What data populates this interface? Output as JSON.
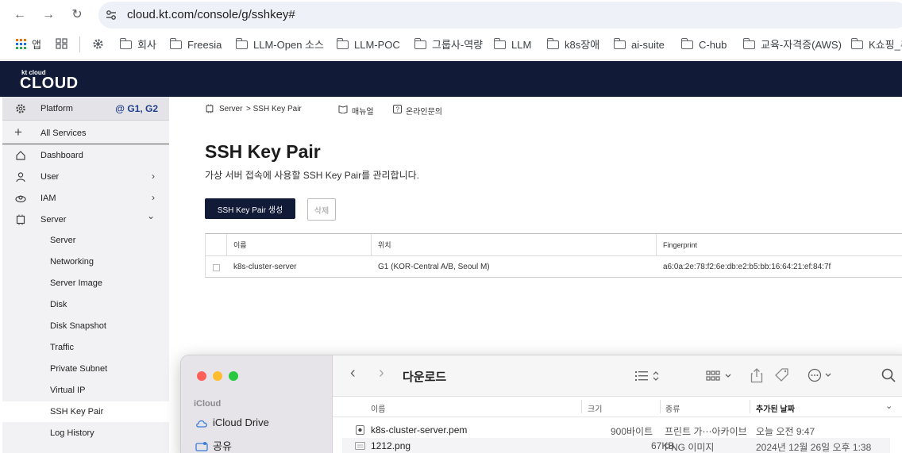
{
  "browser": {
    "url": "cloud.kt.com/console/g/sshkey#",
    "bookmarks": [
      "앱",
      "회사",
      "Freesia",
      "LLM-Open 소스",
      "LLM-POC",
      "그룹사-역량",
      "LLM",
      "k8s장애",
      "ai-suite",
      "C-hub",
      "교육-자격증(AWS)",
      "K쇼핑_추"
    ]
  },
  "header": {
    "logo_small": "kt cloud",
    "logo_big": "CLOUD"
  },
  "sidebar": {
    "platform_label": "Platform",
    "platform_tag": "@ G1, G2",
    "all_services": "All Services",
    "items": [
      {
        "label": "Dashboard",
        "icon": "home-icon"
      },
      {
        "label": "User",
        "icon": "user-icon",
        "chevron": "›"
      },
      {
        "label": "IAM",
        "icon": "iam-icon",
        "chevron": "›"
      },
      {
        "label": "Server",
        "icon": "server-icon",
        "chevron": "⌄"
      }
    ],
    "server_sub": [
      "Server",
      "Networking",
      "Server Image",
      "Disk",
      "Disk Snapshot",
      "Traffic",
      "Private Subnet",
      "Virtual IP",
      "SSH Key Pair",
      "Log History"
    ],
    "active_sub": "SSH Key Pair"
  },
  "breadcrumb": {
    "root": "Server",
    "current": "> SSH Key Pair",
    "manual": "매뉴얼",
    "inquiry": "온라인문의"
  },
  "page": {
    "title": "SSH Key Pair",
    "description": "가상 서버 접속에 사용할 SSH Key Pair를 관리합니다.",
    "create_button": "SSH Key Pair 생성",
    "delete_button": "삭제"
  },
  "table": {
    "headers": [
      "이름",
      "위치",
      "Fingerprint"
    ],
    "rows": [
      {
        "name": "k8s-cluster-server",
        "location": "G1 (KOR-Central A/B, Seoul M)",
        "fingerprint": "a6:0a:2e:78:f2:6e:db:e2:b5:bb:16:64:21:ef:84:7f"
      }
    ]
  },
  "finder": {
    "title": "다운로드",
    "sidebar_section": "iCloud",
    "sidebar_items": [
      "iCloud Drive",
      "공유"
    ],
    "columns": [
      "이름",
      "크기",
      "종류",
      "추가된 날짜"
    ],
    "files": [
      {
        "name": "k8s-cluster-server.pem",
        "size": "900바이트",
        "kind": "프린트 가⋯아카이브",
        "date": "오늘 오전 9:47"
      },
      {
        "name": "1212.png",
        "size": "67KB",
        "kind": "PNG 이미지",
        "date": "2024년 12월 26일 오후 1:38"
      }
    ]
  }
}
